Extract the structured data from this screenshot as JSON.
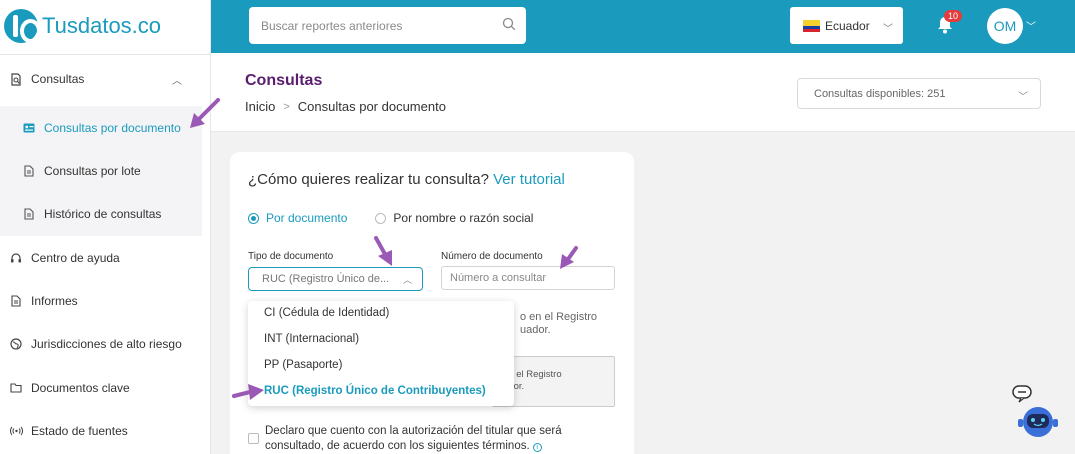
{
  "brand": {
    "name": "Tusdatos.co"
  },
  "sidebar": {
    "section": "Consultas",
    "subitems": [
      {
        "label": "Consultas por documento",
        "icon": "id-card-icon",
        "active": true
      },
      {
        "label": "Consultas por lote",
        "icon": "document-icon",
        "active": false
      },
      {
        "label": "Histórico de consultas",
        "icon": "document-icon",
        "active": false
      }
    ],
    "items": [
      {
        "label": "Centro de ayuda",
        "icon": "headset-icon"
      },
      {
        "label": "Informes",
        "icon": "document-icon"
      },
      {
        "label": "Jurisdicciones de alto riesgo",
        "icon": "globe-icon"
      },
      {
        "label": "Documentos clave",
        "icon": "folder-icon"
      },
      {
        "label": "Estado de fuentes",
        "icon": "signal-icon"
      }
    ]
  },
  "topbar": {
    "search_placeholder": "Buscar reportes anteriores",
    "country": "Ecuador",
    "notifications_count": "10",
    "user_initials": "OM",
    "colors": {
      "primary": "#1a9bbd",
      "badge": "#e43c3c"
    }
  },
  "header": {
    "title": "Consultas",
    "breadcrumb": [
      "Inicio",
      "Consultas por documento"
    ],
    "available": "Consultas disponibles: 251"
  },
  "card": {
    "question": "¿Cómo quieres realizar tu consulta?",
    "tutorial_link": "Ver tutorial",
    "radio_document": "Por documento",
    "radio_name": "Por nombre o razón social",
    "doc_type_label": "Tipo de documento",
    "doc_type_value": "RUC (Registro Único de...",
    "doc_number_label": "Número de documento",
    "doc_number_placeholder": "Número a consultar",
    "hint_line1": "o en el Registro",
    "hint_line2": "uador.",
    "info_line1": "en el Registro",
    "info_line2": "ador.",
    "declare_text": "Declaro que cuento con la autorización del titular que será consultado, de acuerdo con los siguientes términos."
  },
  "dropdown": {
    "options": [
      "CI (Cédula de Identidad)",
      "INT (Internacional)",
      "PP (Pasaporte)",
      "RUC (Registro Único de Contribuyentes)"
    ],
    "selected_index": 3
  }
}
